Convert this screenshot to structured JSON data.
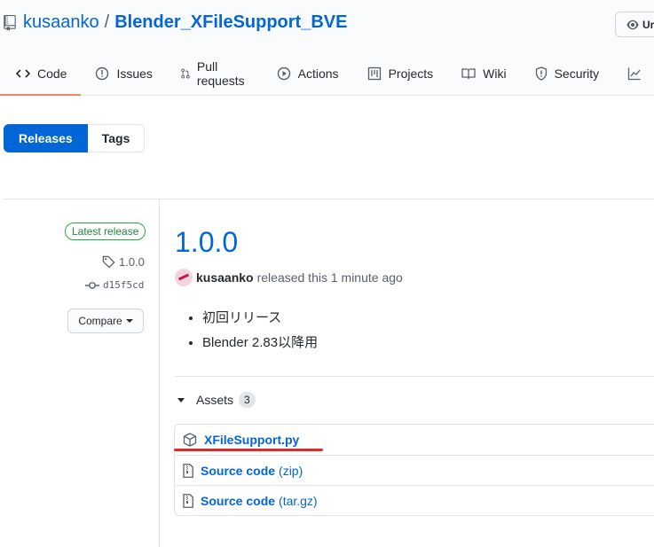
{
  "repo": {
    "owner": "kusaanko",
    "separator": "/",
    "name": "Blender_XFileSupport_BVE",
    "watch_label": "Ur"
  },
  "tabs": [
    {
      "label": "Code",
      "icon": "code-icon"
    },
    {
      "label": "Issues",
      "icon": "issue-icon"
    },
    {
      "label": "Pull requests",
      "icon": "pull-request-icon"
    },
    {
      "label": "Actions",
      "icon": "play-icon"
    },
    {
      "label": "Projects",
      "icon": "project-icon"
    },
    {
      "label": "Wiki",
      "icon": "book-icon"
    },
    {
      "label": "Security",
      "icon": "shield-icon"
    }
  ],
  "subnav": {
    "releases": "Releases",
    "tags": "Tags"
  },
  "release": {
    "badge": "Latest release",
    "tag": "1.0.0",
    "commit": "d15f5cd",
    "compare": "Compare",
    "title": "1.0.0",
    "author": "kusaanko",
    "released_text": "released this 1 minute ago",
    "notes": [
      "初回リリース",
      "Blender 2.83以降用"
    ]
  },
  "assets": {
    "label": "Assets",
    "count": "3",
    "items": [
      {
        "name": "XFileSupport.py",
        "suffix": "",
        "icon": "package-icon"
      },
      {
        "name": "Source code",
        "suffix": "(zip)",
        "icon": "file-zip-icon"
      },
      {
        "name": "Source code",
        "suffix": "(tar.gz)",
        "icon": "file-zip-icon"
      }
    ]
  },
  "colors": {
    "link": "#0366d6",
    "accent_tab": "#f9826c",
    "primary_button": "#0366d6",
    "latest_badge": "#28a745",
    "annotation_underline": "#d32f2f"
  }
}
